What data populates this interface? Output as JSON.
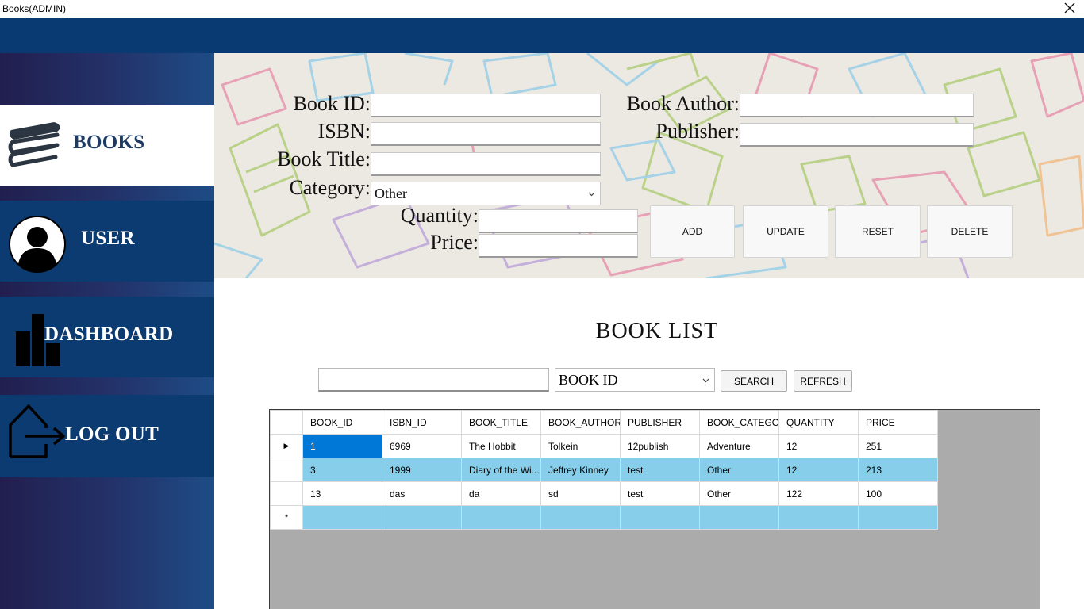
{
  "window": {
    "title": "Books(ADMIN)"
  },
  "sidebar": {
    "items": [
      {
        "label": "BOOKS",
        "icon": "books-stack-icon",
        "active": true
      },
      {
        "label": "USER",
        "icon": "user-avatar-icon",
        "active": false
      },
      {
        "label": "DASHBOARD",
        "icon": "bar-chart-icon",
        "active": false
      },
      {
        "label": "LOG OUT",
        "icon": "logout-house-icon",
        "active": false
      }
    ]
  },
  "form": {
    "book_id_label": "Book ID:",
    "isbn_label": "ISBN:",
    "book_title_label": "Book Title:",
    "category_label": "Category:",
    "category_value": "Other",
    "quantity_label": "Quantity:",
    "price_label": "Price:",
    "book_author_label": "Book Author:",
    "publisher_label": "Publisher:",
    "book_id_value": "",
    "isbn_value": "",
    "book_title_value": "",
    "quantity_value": "",
    "price_value": "",
    "book_author_value": "",
    "publisher_value": ""
  },
  "actions": {
    "add": "ADD",
    "update": "UPDATE",
    "reset": "RESET",
    "delete": "DELETE"
  },
  "list": {
    "title": "BOOK LIST",
    "search_value": "",
    "search_by": "BOOK ID",
    "search_button": "SEARCH",
    "refresh_button": "REFRESH"
  },
  "grid": {
    "columns": [
      "BOOK_ID",
      "ISBN_ID",
      "BOOK_TITLE",
      "BOOK_AUTHOR",
      "PUBLISHER",
      "BOOK_CATEGO",
      "QUANTITY",
      "PRICE"
    ],
    "rows": [
      {
        "marker": "▶",
        "cells": [
          "1",
          "6969",
          "The Hobbit",
          "Tolkein",
          "12publish",
          "Adventure",
          "12",
          "251"
        ]
      },
      {
        "marker": "",
        "cells": [
          "3",
          "1999",
          "Diary of the Wi...",
          "Jeffrey Kinney",
          "test",
          "Other",
          "12",
          "213"
        ]
      },
      {
        "marker": "",
        "cells": [
          "13",
          "das",
          "da",
          "sd",
          "test",
          "Other",
          "122",
          "100"
        ]
      }
    ],
    "new_row_marker": "*"
  },
  "colors": {
    "nav_dark": "#0c3b71",
    "top_band": "#0a3a72",
    "grid_selected": "#0078d7",
    "grid_alt_row": "#87ceeb",
    "grid_background": "#ababab"
  }
}
